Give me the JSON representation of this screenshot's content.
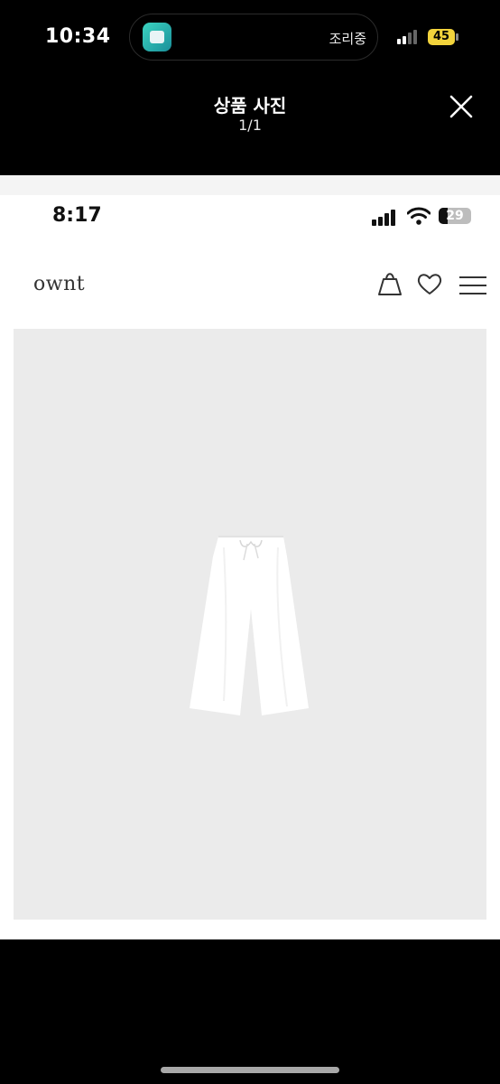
{
  "outer_status": {
    "time": "10:34",
    "live_activity_app_icon": "delivery-app-icon",
    "live_activity_status": "조리중",
    "battery_level": "45"
  },
  "viewer": {
    "title": "상품 사진",
    "counter": "1/1",
    "close_icon": "close-icon"
  },
  "photo": {
    "status_bar": {
      "time": "8:17",
      "battery_level": "29",
      "battery_fraction": 0.29
    },
    "header": {
      "logo": "ownt",
      "icons": [
        "shopping-bag-icon",
        "heart-icon",
        "menu-icon"
      ]
    },
    "product_image": "white-wide-pants"
  },
  "colors": {
    "background": "#000000",
    "battery_yellow": "#f2d33c",
    "product_bg": "#ebebeb"
  }
}
